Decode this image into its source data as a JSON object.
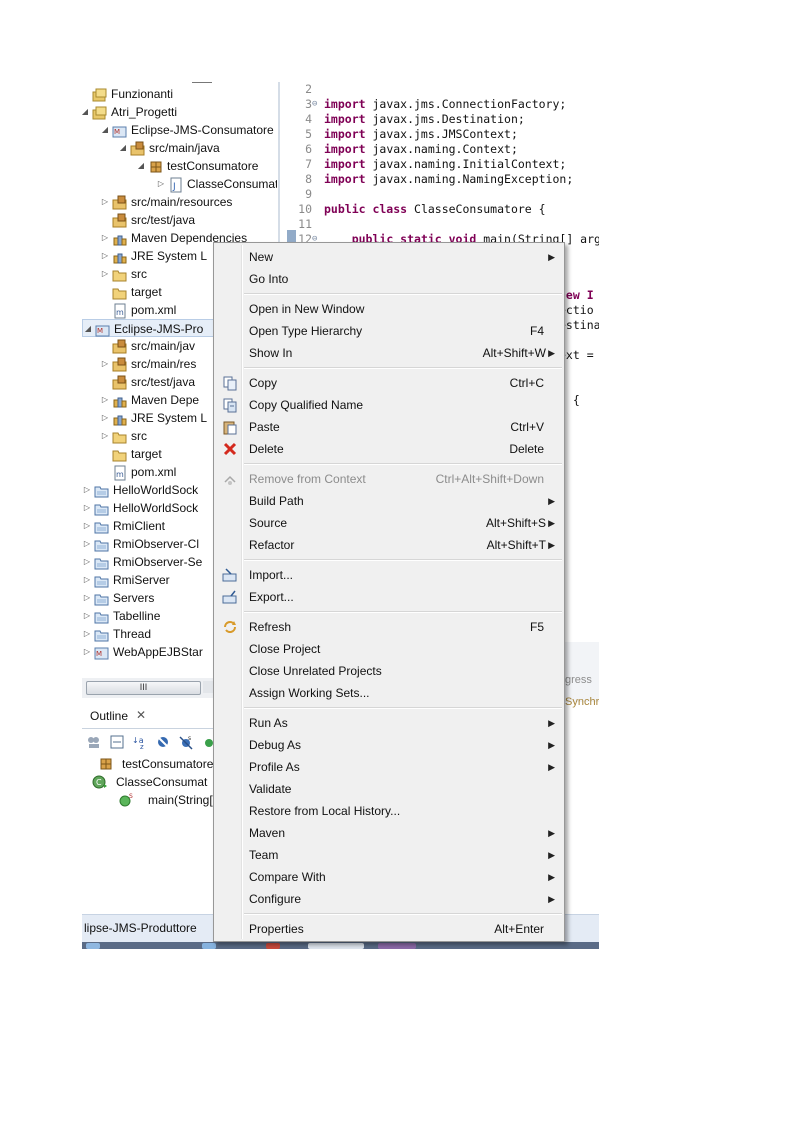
{
  "explorer": {
    "rows": [
      {
        "label": "Funzionanti",
        "icon": "working-set-icon",
        "expanded": "none"
      },
      {
        "label": "Atri_Progetti",
        "icon": "working-set-icon",
        "expanded": "open"
      },
      {
        "label": "Eclipse-JMS-Consumatore",
        "icon": "maven-project-icon",
        "expanded": "open"
      },
      {
        "label": "src/main/java",
        "icon": "source-folder-icon",
        "expanded": "open"
      },
      {
        "label": "testConsumatore",
        "icon": "package-icon",
        "expanded": "open"
      },
      {
        "label": "ClasseConsumat",
        "icon": "java-file-icon",
        "expanded": "closed"
      },
      {
        "label": "src/main/resources",
        "icon": "source-folder-icon",
        "expanded": "closed"
      },
      {
        "label": "src/test/java",
        "icon": "source-folder-icon",
        "expanded": "none"
      },
      {
        "label": "Maven Dependencies",
        "icon": "library-icon",
        "expanded": "closed"
      },
      {
        "label": "JRE System L",
        "icon": "library-icon",
        "expanded": "closed"
      },
      {
        "label": "src",
        "icon": "folder-icon",
        "expanded": "closed"
      },
      {
        "label": "target",
        "icon": "folder-icon",
        "expanded": "none"
      },
      {
        "label": "pom.xml",
        "icon": "xml-file-icon",
        "expanded": "none"
      },
      {
        "label": "Eclipse-JMS-Pro",
        "icon": "maven-project-icon",
        "expanded": "open"
      },
      {
        "label": "src/main/jav",
        "icon": "source-folder-icon",
        "expanded": "none"
      },
      {
        "label": "src/main/res",
        "icon": "source-folder-icon",
        "expanded": "closed"
      },
      {
        "label": "src/test/java",
        "icon": "source-folder-icon",
        "expanded": "none"
      },
      {
        "label": "Maven Depe",
        "icon": "library-icon",
        "expanded": "closed"
      },
      {
        "label": "JRE System L",
        "icon": "library-icon",
        "expanded": "closed"
      },
      {
        "label": "src",
        "icon": "folder-icon",
        "expanded": "closed"
      },
      {
        "label": "target",
        "icon": "folder-icon",
        "expanded": "none"
      },
      {
        "label": "pom.xml",
        "icon": "xml-file-icon",
        "expanded": "none"
      },
      {
        "label": "HelloWorldSock",
        "icon": "project-icon",
        "expanded": "closed"
      },
      {
        "label": "HelloWorldSock",
        "icon": "project-icon",
        "expanded": "closed"
      },
      {
        "label": "RmiClient",
        "icon": "project-icon",
        "expanded": "closed"
      },
      {
        "label": "RmiObserver-Cl",
        "icon": "project-icon",
        "expanded": "closed"
      },
      {
        "label": "RmiObserver-Se",
        "icon": "project-icon",
        "expanded": "closed"
      },
      {
        "label": "RmiServer",
        "icon": "project-icon",
        "expanded": "closed"
      },
      {
        "label": "Servers",
        "icon": "project-icon",
        "expanded": "closed"
      },
      {
        "label": "Tabelline",
        "icon": "project-icon",
        "expanded": "closed"
      },
      {
        "label": "Thread",
        "icon": "project-icon",
        "expanded": "closed"
      },
      {
        "label": "WebAppEJBStar",
        "icon": "web-project-icon",
        "expanded": "closed"
      }
    ],
    "scroll_thumb": "III"
  },
  "outline": {
    "title": "Outline",
    "close_glyph": "✕",
    "toolbar_icons": [
      "collapse-all-icon",
      "hide-fields-icon",
      "sort-az-icon",
      "hide-static-icon",
      "hide-non-public-icon",
      "focus-icon"
    ],
    "items": [
      {
        "label": "testConsumatore",
        "icon": "package-icon"
      },
      {
        "label": "ClasseConsumat",
        "icon": "class-icon"
      },
      {
        "label": "main(String[",
        "icon": "method-icon"
      }
    ]
  },
  "editor": {
    "lines": [
      {
        "n": "2",
        "tokens": []
      },
      {
        "n": "3",
        "fold": "⊖",
        "tokens": [
          {
            "k": "import"
          },
          {
            "t": " javax.jms.ConnectionFactory;"
          }
        ]
      },
      {
        "n": "4",
        "tokens": [
          {
            "k": "import"
          },
          {
            "t": " javax.jms.Destination;"
          }
        ]
      },
      {
        "n": "5",
        "tokens": [
          {
            "k": "import"
          },
          {
            "t": " javax.jms.JMSContext;"
          }
        ]
      },
      {
        "n": "6",
        "tokens": [
          {
            "k": "import"
          },
          {
            "t": " javax.naming.Context;"
          }
        ]
      },
      {
        "n": "7",
        "tokens": [
          {
            "k": "import"
          },
          {
            "t": " javax.naming.InitialContext;"
          }
        ]
      },
      {
        "n": "8",
        "tokens": [
          {
            "k": "import"
          },
          {
            "t": " javax.naming.NamingException;"
          }
        ]
      },
      {
        "n": "9",
        "tokens": []
      },
      {
        "n": "10",
        "tokens": [
          {
            "k": "public class"
          },
          {
            "t": " ClasseConsumatore {"
          }
        ]
      },
      {
        "n": "11",
        "tokens": []
      },
      {
        "n": "12",
        "fold": "⊖",
        "tokens": [
          {
            "t": "    "
          },
          {
            "k": "public static void"
          },
          {
            "t": " main(String[] arg"
          }
        ]
      }
    ],
    "fragments": [
      {
        "text": "new I"
      },
      {
        "text": "ectio"
      },
      {
        "text": "estina"
      },
      {
        "text": "ext ="
      },
      {
        "text": ") {"
      }
    ]
  },
  "right_panel": {
    "progress": "gress",
    "synch": "Synchr"
  },
  "context_menu": {
    "items": [
      {
        "label": "New",
        "submenu": true
      },
      {
        "label": "Go Into"
      },
      {
        "sep": true
      },
      {
        "label": "Open in New Window"
      },
      {
        "label": "Open Type Hierarchy",
        "shortcut": "F4"
      },
      {
        "label": "Show In",
        "shortcut": "Alt+Shift+W",
        "submenu": true
      },
      {
        "sep": true
      },
      {
        "label": "Copy",
        "shortcut": "Ctrl+C",
        "icon": "copy-icon"
      },
      {
        "label": "Copy Qualified Name",
        "icon": "copy-qualified-icon"
      },
      {
        "label": "Paste",
        "shortcut": "Ctrl+V",
        "icon": "paste-icon"
      },
      {
        "label": "Delete",
        "shortcut": "Delete",
        "icon": "delete-icon"
      },
      {
        "sep": true
      },
      {
        "label": "Remove from Context",
        "shortcut": "Ctrl+Alt+Shift+Down",
        "icon": "remove-context-icon",
        "disabled": true
      },
      {
        "label": "Build Path",
        "submenu": true
      },
      {
        "label": "Source",
        "shortcut": "Alt+Shift+S",
        "submenu": true
      },
      {
        "label": "Refactor",
        "shortcut": "Alt+Shift+T",
        "submenu": true
      },
      {
        "sep": true
      },
      {
        "label": "Import...",
        "icon": "import-icon"
      },
      {
        "label": "Export...",
        "icon": "export-icon"
      },
      {
        "sep": true
      },
      {
        "label": "Refresh",
        "shortcut": "F5",
        "icon": "refresh-icon"
      },
      {
        "label": "Close Project"
      },
      {
        "label": "Close Unrelated Projects"
      },
      {
        "label": "Assign Working Sets..."
      },
      {
        "sep": true
      },
      {
        "label": "Run As",
        "submenu": true
      },
      {
        "label": "Debug As",
        "submenu": true
      },
      {
        "label": "Profile As",
        "submenu": true
      },
      {
        "label": "Validate"
      },
      {
        "label": "Restore from Local History..."
      },
      {
        "label": "Maven",
        "submenu": true
      },
      {
        "label": "Team",
        "submenu": true
      },
      {
        "label": "Compare With",
        "submenu": true
      },
      {
        "label": "Configure",
        "submenu": true
      },
      {
        "sep": true
      },
      {
        "label": "Properties",
        "shortcut": "Alt+Enter"
      }
    ],
    "submenu_glyph": "▶"
  },
  "status_bar": {
    "text": "lipse-JMS-Produttore"
  },
  "colors": {
    "keyword": "#7f0055",
    "accent": "#6d8fb5",
    "menu_bg": "#f0f0f0"
  }
}
